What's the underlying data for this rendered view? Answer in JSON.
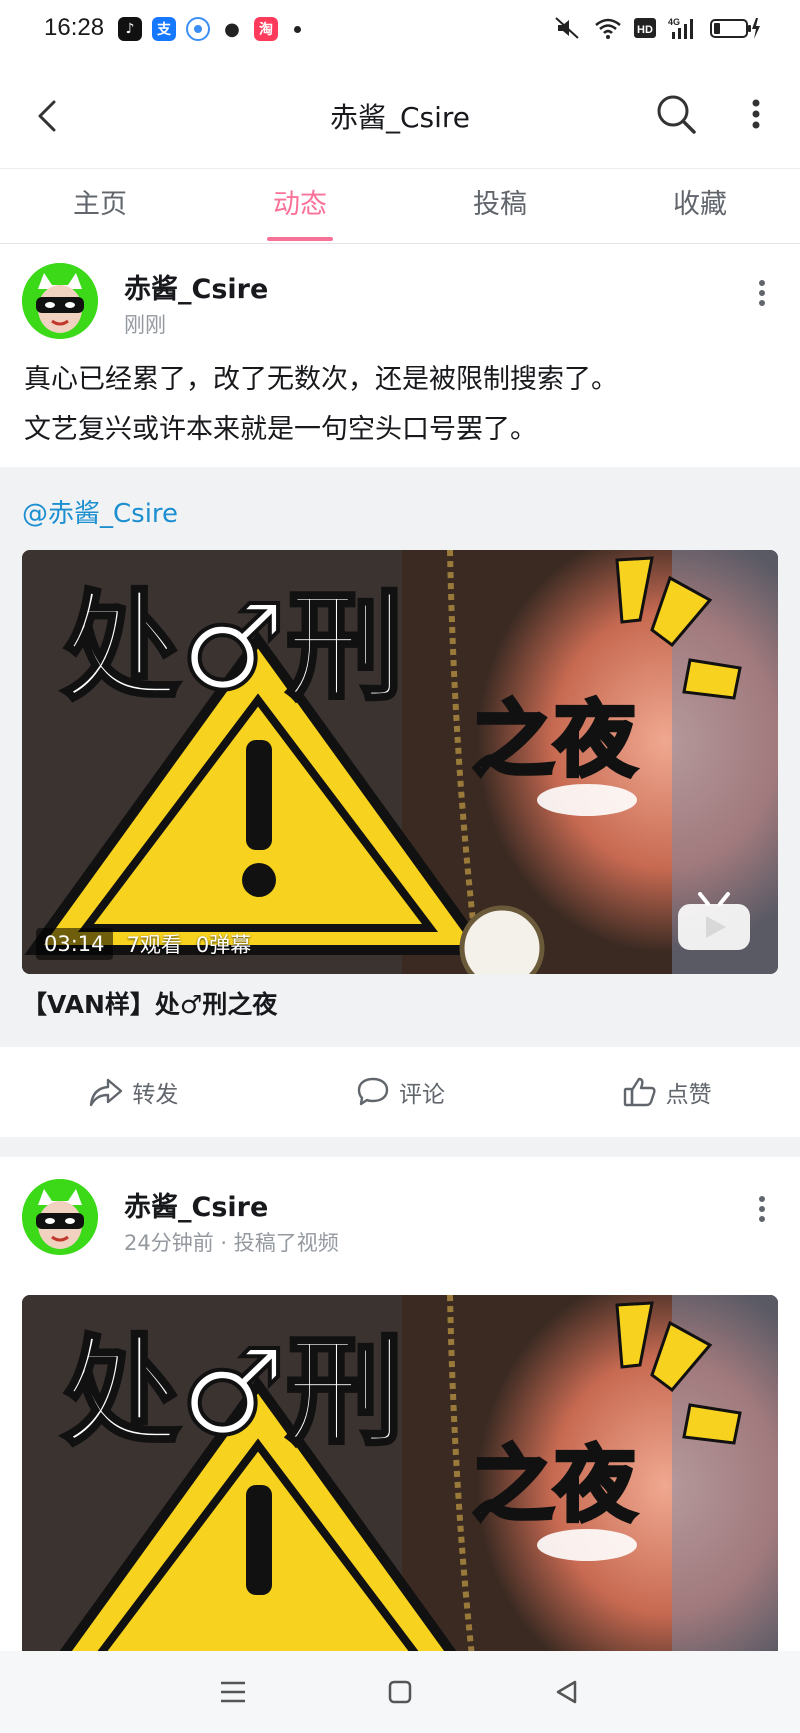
{
  "status_bar": {
    "time": "16:28",
    "apps": [
      "tiktok-icon",
      "alipay-icon",
      "browser-icon",
      "wechat-icon",
      "taobao-icon"
    ],
    "right_icons": [
      "mute-icon",
      "wifi-icon",
      "hd-icon",
      "4g-signal-icon",
      "battery-charging-icon"
    ]
  },
  "header": {
    "title": "赤酱_Csire"
  },
  "tabs": [
    {
      "label": "主页",
      "active": false
    },
    {
      "label": "动态",
      "active": true
    },
    {
      "label": "投稿",
      "active": false
    },
    {
      "label": "收藏",
      "active": false
    }
  ],
  "post1": {
    "author": "赤酱_Csire",
    "time": "刚刚",
    "text_line1": "真心已经累了，改了无数次，还是被限制搜索了。",
    "text_line2": "文艺复兴或许本来就是一句空头口号罢了。",
    "repost": {
      "at_author": "@赤酱_Csire",
      "video": {
        "duration": "03:14",
        "views": "7观看",
        "danmaku": "0弹幕",
        "title": "【VAN样】处♂刑之夜",
        "thumb_big_text": "处♂刑",
        "thumb_sub_text": "之夜"
      }
    },
    "actions": {
      "share": "转发",
      "comment": "评论",
      "like": "点赞"
    }
  },
  "post2": {
    "author": "赤酱_Csire",
    "time": "24分钟前 · 投稿了视频",
    "video": {
      "thumb_big_text": "处♂刑",
      "thumb_sub_text": "之夜"
    }
  },
  "colors": {
    "accent": "#fb7299",
    "link": "#1c8fd1",
    "avatar_bg": "#3cd919",
    "thumb_yellow": "#f7d21e"
  }
}
